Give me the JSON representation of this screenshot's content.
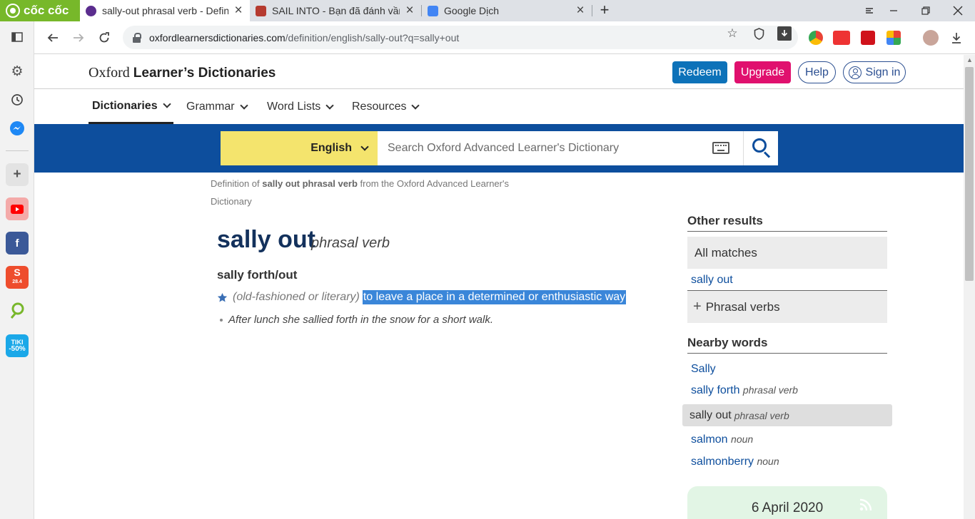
{
  "browser": {
    "brand": "cốc cốc",
    "tabs": [
      {
        "title": "sally-out phrasal verb - Definiti",
        "active": true
      },
      {
        "title": "SAIL INTO - Bạn đã đánh vần",
        "active": false
      },
      {
        "title": "Google Dịch",
        "active": false
      }
    ],
    "url_host": "oxfordlearnersdictionaries.com",
    "url_path": "/definition/english/sally-out?q=sally+out"
  },
  "sidebar": {
    "badge_shopee": "28.4",
    "tiki_label": "TIKI",
    "tiki_promo": "-50%"
  },
  "site": {
    "logo_oxford": "Oxford",
    "logo_rest": "Learner’s Dictionaries",
    "buttons": {
      "redeem": "Redeem",
      "upgrade": "Upgrade",
      "help": "Help",
      "signin": "Sign in"
    },
    "nav": [
      "Dictionaries",
      "Grammar",
      "Word Lists",
      "Resources"
    ],
    "search": {
      "language": "English",
      "placeholder": "Search Oxford Advanced Learner's Dictionary"
    }
  },
  "entry": {
    "definition_of_prefix": "Definition of ",
    "definition_of_term": "sally out phrasal verb",
    "definition_of_suffix": " from the Oxford Advanced Learner's Dictionary",
    "headword": "sally out",
    "pos": "phrasal verb",
    "idiom": "sally forth/out",
    "labels": "(old-fashioned or literary)",
    "definition": "to leave a place in a determined or enthusiastic way",
    "example": "After lunch she sallied forth in the snow for a short walk."
  },
  "sidebar_results": {
    "other_results_title": "Other results",
    "all_matches": "All matches",
    "all_matches_item": "sally out",
    "phrasal_verbs": "Phrasal verbs",
    "nearby_title": "Nearby words",
    "nearby": [
      {
        "word": "Sally",
        "pos": ""
      },
      {
        "word": "sally forth",
        "pos": "phrasal verb"
      },
      {
        "word": "sally out",
        "pos": "phrasal verb"
      },
      {
        "word": "salmon",
        "pos": "noun"
      },
      {
        "word": "salmonberry",
        "pos": "noun"
      }
    ],
    "word_of_day_date": "6 April 2020"
  },
  "colors": {
    "brand_green": "#77b82a",
    "oxford_blue": "#0d4e9d",
    "redeem": "#0d72b9",
    "upgrade": "#e0106e",
    "highlight": "#3a86d9"
  }
}
